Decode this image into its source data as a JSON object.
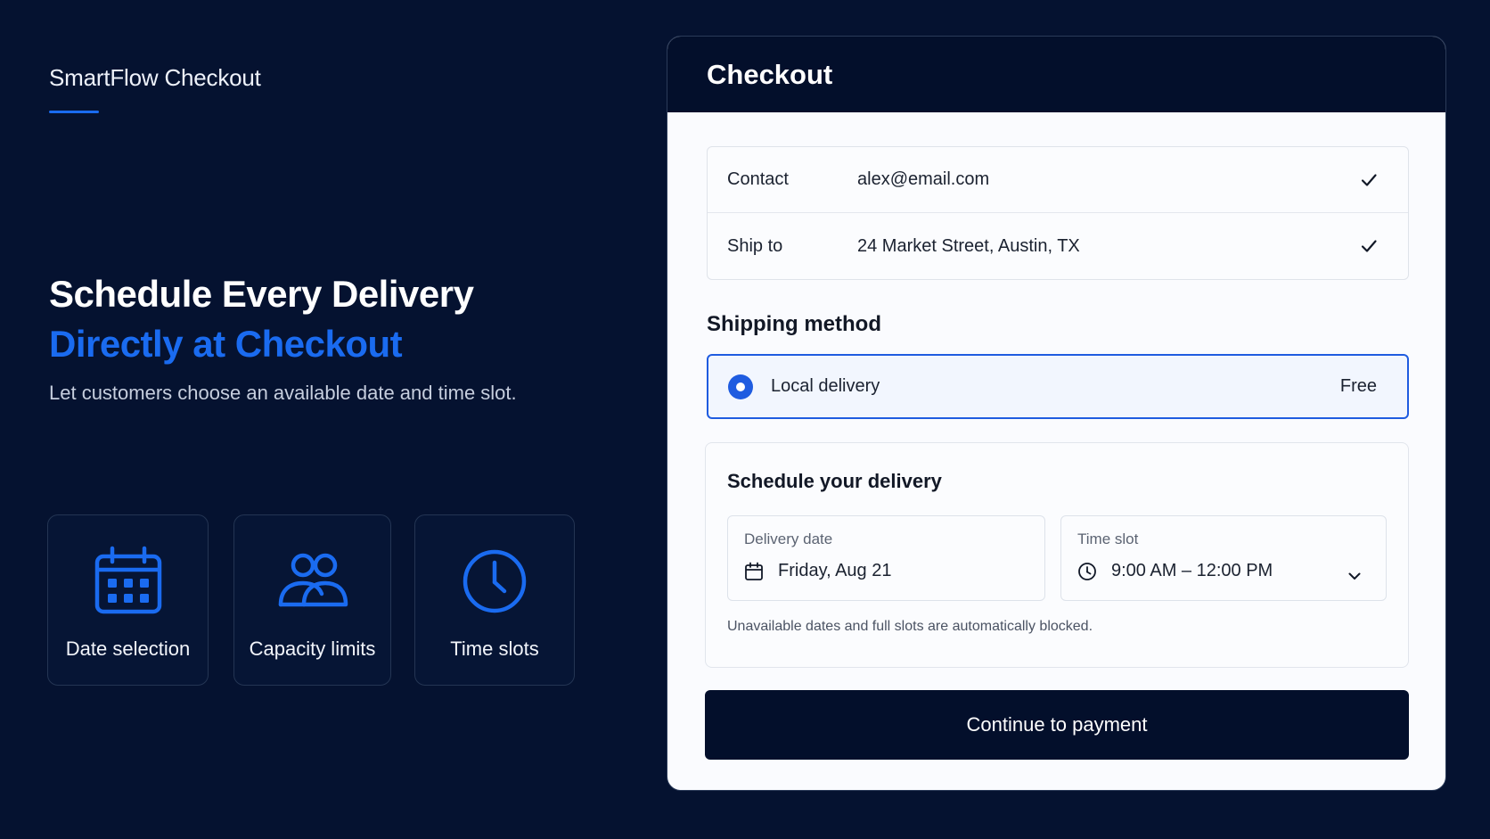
{
  "brand": {
    "name": "SmartFlow Checkout"
  },
  "hero": {
    "headline_line1": "Schedule Every Delivery",
    "headline_line2": "Directly at Checkout",
    "subtext": "Let customers choose an available date and time slot."
  },
  "features": [
    {
      "label": "Date selection",
      "icon": "calendar-icon"
    },
    {
      "label": "Capacity limits",
      "icon": "users-icon"
    },
    {
      "label": "Time slots",
      "icon": "clock-icon"
    }
  ],
  "checkout": {
    "title": "Checkout",
    "contact": {
      "label": "Contact",
      "value": "alex@email.com"
    },
    "ship_to": {
      "label": "Ship to",
      "value": "24 Market Street, Austin, TX"
    },
    "shipping_method": {
      "title": "Shipping method",
      "option": {
        "label": "Local delivery",
        "price": "Free",
        "selected": true
      }
    },
    "schedule": {
      "title": "Schedule your delivery",
      "delivery_date": {
        "label": "Delivery date",
        "value": "Friday, Aug 21"
      },
      "time_slot": {
        "label": "Time slot",
        "value": "9:00 AM – 12:00 PM"
      },
      "note": "Unavailable dates and full slots are automatically blocked."
    },
    "continue_label": "Continue to payment"
  },
  "colors": {
    "background": "#051230",
    "accent": "#1a6bf0",
    "card_header": "#030f2b",
    "selected_border": "#1f5ce0"
  }
}
